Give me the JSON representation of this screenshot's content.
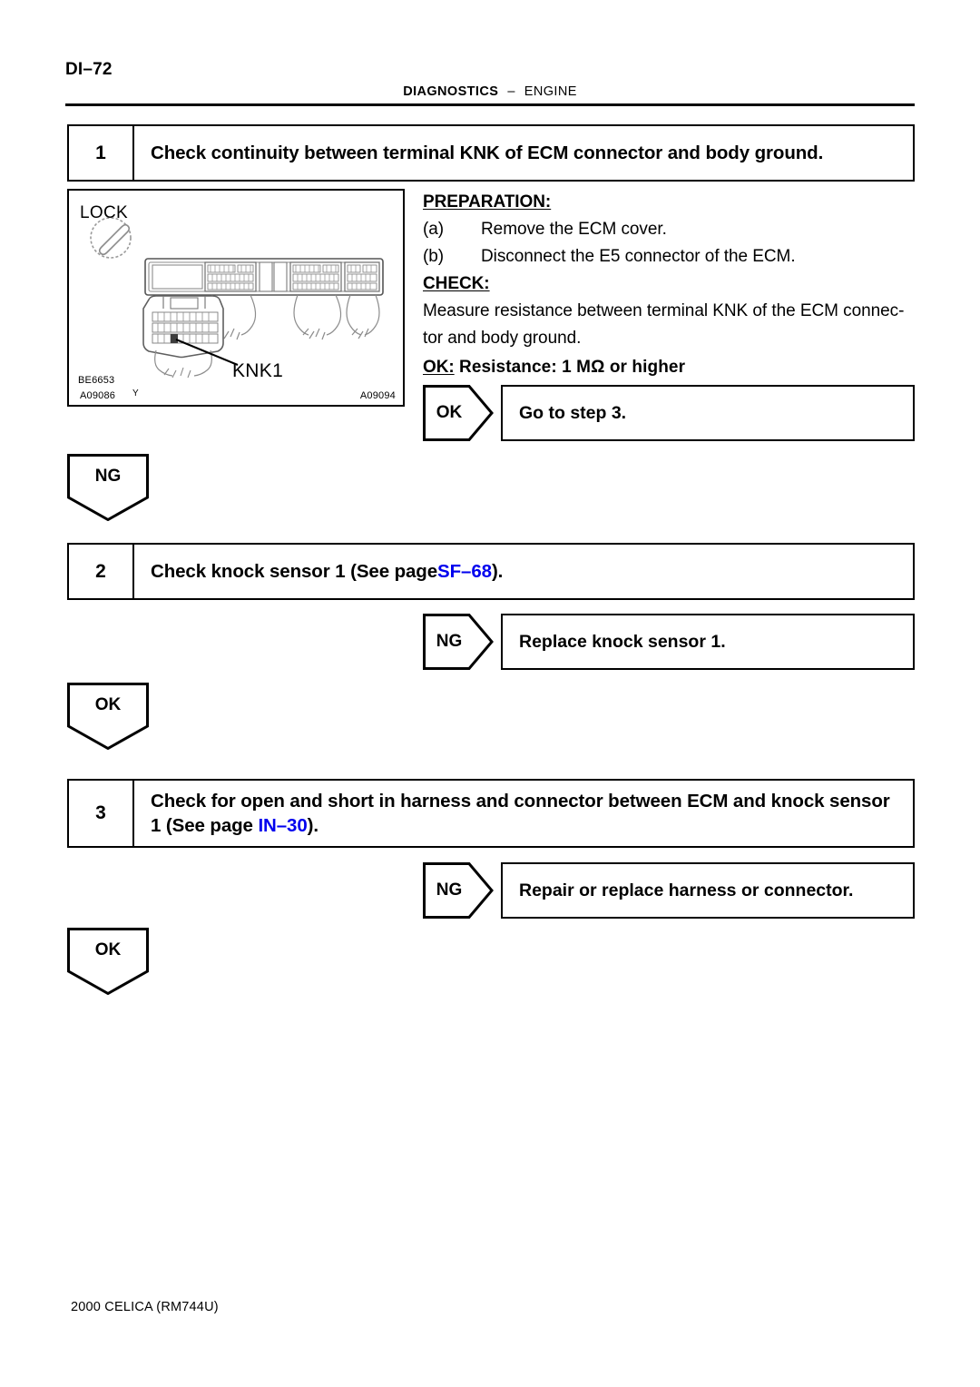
{
  "header": {
    "page_number": "DI–72",
    "section": "DIAGNOSTICS",
    "separator": "–",
    "subsection": "ENGINE"
  },
  "figure": {
    "lock_label": "LOCK",
    "terminal_label": "KNK1",
    "code_left_top": "BE6653",
    "code_left_bottom": "A09086",
    "code_right": "A09094",
    "mark": "Y"
  },
  "steps": [
    {
      "number": "1",
      "title": "Check continuity between terminal KNK of ECM connector and body ground."
    },
    {
      "number": "2",
      "title_before": "Check knock sensor 1 (See page ",
      "title_link": "SF–68",
      "title_after": ")."
    },
    {
      "number": "3",
      "title_before": "Check for open and short in harness and connector between ECM and knock sensor 1 (See page ",
      "title_link": "IN–30",
      "title_after": ")."
    }
  ],
  "instructions": {
    "preparation_heading": "PREPARATION:",
    "prep_a_marker": "(a)",
    "prep_a_text": "Remove the ECM cover.",
    "prep_b_marker": "(b)",
    "prep_b_text": "Disconnect the E5 connector of the ECM.",
    "check_heading": "CHECK:",
    "check_line1": "Measure resistance between terminal KNK of the ECM connec-",
    "check_line2": "tor and body ground.",
    "ok_heading": "OK:",
    "ok_spec": "Resistance: 1 MΩ or higher"
  },
  "results": [
    {
      "label": "OK",
      "text": "Go to step 3."
    },
    {
      "label": "NG",
      "text": "Replace knock sensor 1."
    },
    {
      "label": "NG",
      "text": "Repair or replace harness or connector."
    }
  ],
  "flow_markers": [
    {
      "label": "NG"
    },
    {
      "label": "OK"
    },
    {
      "label": "OK"
    }
  ],
  "footer": {
    "text": "2000 CELICA   (RM744U)"
  },
  "colors": {
    "link": "#0000ee",
    "ink": "#000000",
    "figure_line": "#7a7a7a"
  }
}
